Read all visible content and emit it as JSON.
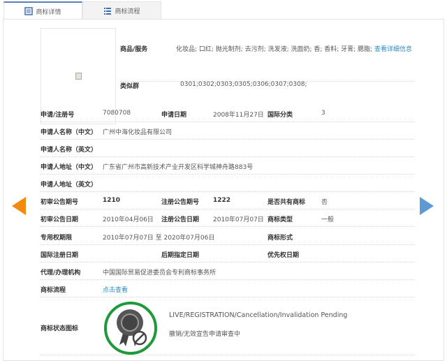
{
  "tabs": [
    {
      "label": "商标详情",
      "icon": "document-icon",
      "active": true
    },
    {
      "label": "商标流程",
      "icon": "list-icon",
      "active": false
    }
  ],
  "goods": {
    "label": "商品/服务",
    "value": "化妆品; 口红; 抛光制剂; 去污剂; 洗发液; 洗面奶; 香; 香料; 牙膏; 腮脂;",
    "link": "查看详细信息"
  },
  "similar": {
    "label": "类似群",
    "value": "0301;0302;0303;0305;0306;0307;0308;"
  },
  "rows": {
    "reg_no_label": "申请/注册号",
    "reg_no": "7080708",
    "app_date_label": "申请日期",
    "app_date": "2008年11月27日",
    "intl_class_label": "国际分类",
    "intl_class": "3",
    "applicant_cn_label": "申请人名称（中文）",
    "applicant_cn": "广州中海化妆品有限公司",
    "applicant_en_label": "申请人名称（英文）",
    "addr_cn_label": "申请人地址（中文）",
    "addr_cn": "广东省广州市高新技术产业开发区科学城神舟路883号",
    "addr_en_label": "申请人地址（英文）",
    "prelim_no_label": "初审公告期号",
    "prelim_no": "1210",
    "reg_pub_no_label": "注册公告期号",
    "reg_pub_no": "1222",
    "shared_label": "是否共有商标",
    "shared": "否",
    "prelim_date_label": "初审公告日期",
    "prelim_date": "2010年04月06日",
    "reg_pub_date_label": "注册公告日期",
    "reg_pub_date": "2010年07月07日",
    "tm_type_label": "商标类型",
    "tm_type": "一般",
    "term_label": "专用权期限",
    "term": "2010年07月07日 至 2020年07月06日",
    "tm_form_label": "商标形式",
    "intl_reg_label": "国际注册日期",
    "later_label": "后期指定日期",
    "priority_label": "优先权日期",
    "agent_label": "代理/办理机构",
    "agent": "中国国际贸易促进委员会专利商标事务所",
    "flow_label": "商标流程",
    "flow_link": "点击查看",
    "status_label": "商标状态图标",
    "status_en": "LIVE/REGISTRATION/Cancellation/Invalidation Pending",
    "status_cn": "撤销/无效宣告申请审查中"
  },
  "colors": {
    "prev_arrow": "#f08a10",
    "next_arrow": "#5b9ad5",
    "badge_ring": "#1e9a3a",
    "link": "#2a8bc7"
  }
}
